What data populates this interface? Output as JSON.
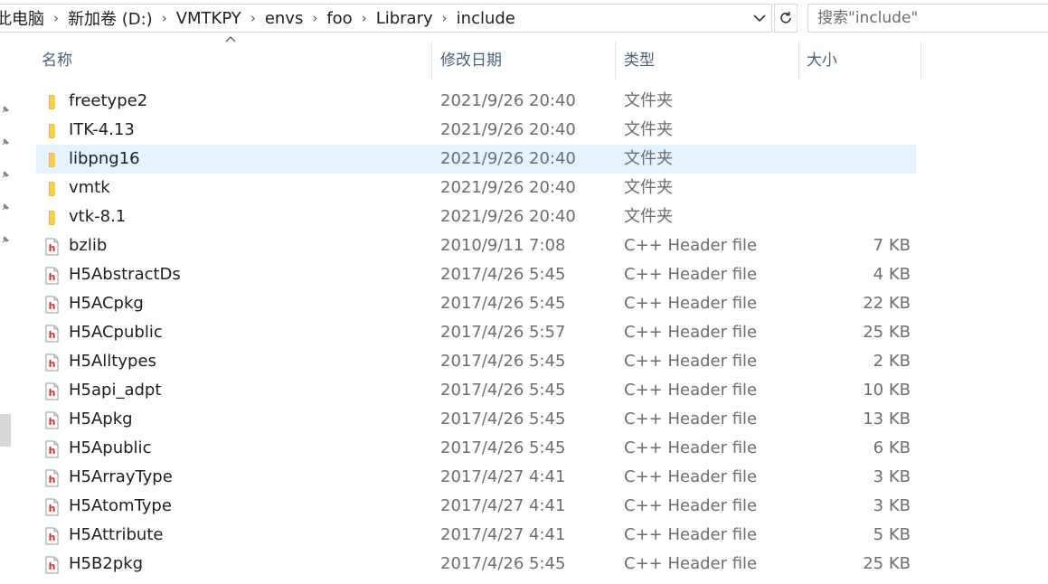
{
  "address": {
    "crumbs": [
      "此电脑",
      "新加卷 (D:)",
      "VMTKPY",
      "envs",
      "foo",
      "Library",
      "include"
    ],
    "separator": "›"
  },
  "search": {
    "placeholder": "搜索\"include\""
  },
  "columns": {
    "name": "名称",
    "date": "修改日期",
    "type": "类型",
    "size": "大小"
  },
  "rows": [
    {
      "name": "freetype2",
      "date": "2021/9/26 20:40",
      "type": "文件夹",
      "size": "",
      "kind": "folder-icon"
    },
    {
      "name": "ITK-4.13",
      "date": "2021/9/26 20:40",
      "type": "文件夹",
      "size": "",
      "kind": "folder-icon"
    },
    {
      "name": "libpng16",
      "date": "2021/9/26 20:40",
      "type": "文件夹",
      "size": "",
      "kind": "folder-icon",
      "highlighted": true
    },
    {
      "name": "vmtk",
      "date": "2021/9/26 20:40",
      "type": "文件夹",
      "size": "",
      "kind": "folder-icon"
    },
    {
      "name": "vtk-8.1",
      "date": "2021/9/26 20:40",
      "type": "文件夹",
      "size": "",
      "kind": "folder-icon"
    },
    {
      "name": "bzlib",
      "date": "2010/9/11 7:08",
      "type": "C++ Header file",
      "size": "7 KB",
      "kind": "header-file-icon"
    },
    {
      "name": "H5AbstractDs",
      "date": "2017/4/26 5:45",
      "type": "C++ Header file",
      "size": "4 KB",
      "kind": "header-file-icon"
    },
    {
      "name": "H5ACpkg",
      "date": "2017/4/26 5:45",
      "type": "C++ Header file",
      "size": "22 KB",
      "kind": "header-file-icon"
    },
    {
      "name": "H5ACpublic",
      "date": "2017/4/26 5:57",
      "type": "C++ Header file",
      "size": "25 KB",
      "kind": "header-file-icon"
    },
    {
      "name": "H5Alltypes",
      "date": "2017/4/26 5:45",
      "type": "C++ Header file",
      "size": "2 KB",
      "kind": "header-file-icon"
    },
    {
      "name": "H5api_adpt",
      "date": "2017/4/26 5:45",
      "type": "C++ Header file",
      "size": "10 KB",
      "kind": "header-file-icon"
    },
    {
      "name": "H5Apkg",
      "date": "2017/4/26 5:45",
      "type": "C++ Header file",
      "size": "13 KB",
      "kind": "header-file-icon"
    },
    {
      "name": "H5Apublic",
      "date": "2017/4/26 5:45",
      "type": "C++ Header file",
      "size": "6 KB",
      "kind": "header-file-icon"
    },
    {
      "name": "H5ArrayType",
      "date": "2017/4/27 4:41",
      "type": "C++ Header file",
      "size": "3 KB",
      "kind": "header-file-icon"
    },
    {
      "name": "H5AtomType",
      "date": "2017/4/27 4:41",
      "type": "C++ Header file",
      "size": "3 KB",
      "kind": "header-file-icon"
    },
    {
      "name": "H5Attribute",
      "date": "2017/4/27 4:41",
      "type": "C++ Header file",
      "size": "5 KB",
      "kind": "header-file-icon"
    },
    {
      "name": "H5B2pkg",
      "date": "2017/4/26 5:45",
      "type": "C++ Header file",
      "size": "25 KB",
      "kind": "header-file-icon"
    }
  ],
  "colors": {
    "accent_hover": "#e5f3ff",
    "folder": "#f5c542",
    "header_icon": "#c0392b"
  }
}
